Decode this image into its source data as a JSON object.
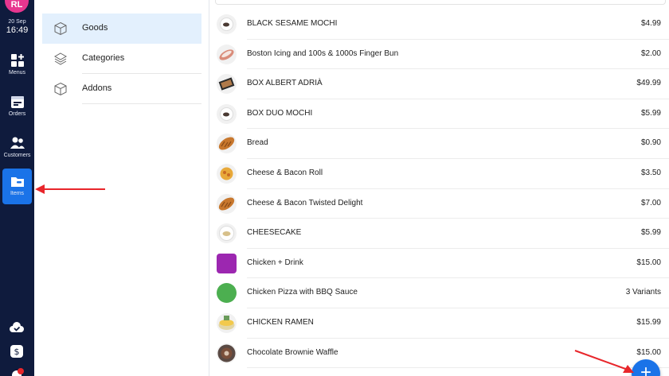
{
  "rail": {
    "avatar_initials": "RL",
    "date": "20 Sep",
    "time": "16:49",
    "items": [
      {
        "label": "Menus",
        "icon": "grid-plus-icon"
      },
      {
        "label": "Orders",
        "icon": "orders-icon"
      },
      {
        "label": "Customers",
        "icon": "users-icon"
      },
      {
        "label": "Items",
        "icon": "folder-icon",
        "active": true
      }
    ],
    "bottom_icons": [
      "cloud-check-icon",
      "cash-register-icon",
      "notification-icon"
    ],
    "active_color": "#1a73e8",
    "background_color": "#0f1b3d"
  },
  "subnav": {
    "items": [
      {
        "label": "Goods",
        "icon": "box-icon",
        "active": true
      },
      {
        "label": "Categories",
        "icon": "layers-icon"
      },
      {
        "label": "Addons",
        "icon": "box-icon"
      }
    ]
  },
  "products": [
    {
      "name": "BLACK SESAME MOCHI",
      "price": "$4.99",
      "thumb": "mochi"
    },
    {
      "name": "Boston Icing and 100s & 1000s Finger Bun",
      "price": "$2.00",
      "thumb": "bun"
    },
    {
      "name": "BOX ALBERT ADRIÀ",
      "price": "$49.99",
      "thumb": "box"
    },
    {
      "name": "BOX DUO MOCHI",
      "price": "$5.99",
      "thumb": "mochi"
    },
    {
      "name": "Bread",
      "price": "$0.90",
      "thumb": "bread"
    },
    {
      "name": "Cheese & Bacon Roll",
      "price": "$3.50",
      "thumb": "roll"
    },
    {
      "name": "Cheese & Bacon Twisted Delight",
      "price": "$7.00",
      "thumb": "bread"
    },
    {
      "name": "CHEESECAKE",
      "price": "$5.99",
      "thumb": "cake"
    },
    {
      "name": "Chicken + Drink",
      "price": "$15.00",
      "thumb": "swatch",
      "swatch_color": "#9c27b0"
    },
    {
      "name": "Chicken Pizza with BBQ Sauce",
      "price": "3 Variants",
      "thumb": "swatch-round",
      "swatch_color": "#4caf50"
    },
    {
      "name": "CHICKEN RAMEN",
      "price": "$15.99",
      "thumb": "ramen"
    },
    {
      "name": "Chocolate Brownie Waffle",
      "price": "$15.00",
      "thumb": "waffle"
    }
  ],
  "fab": {
    "label": "+",
    "color": "#1a73e8"
  },
  "annotation_color": "#e8262b"
}
